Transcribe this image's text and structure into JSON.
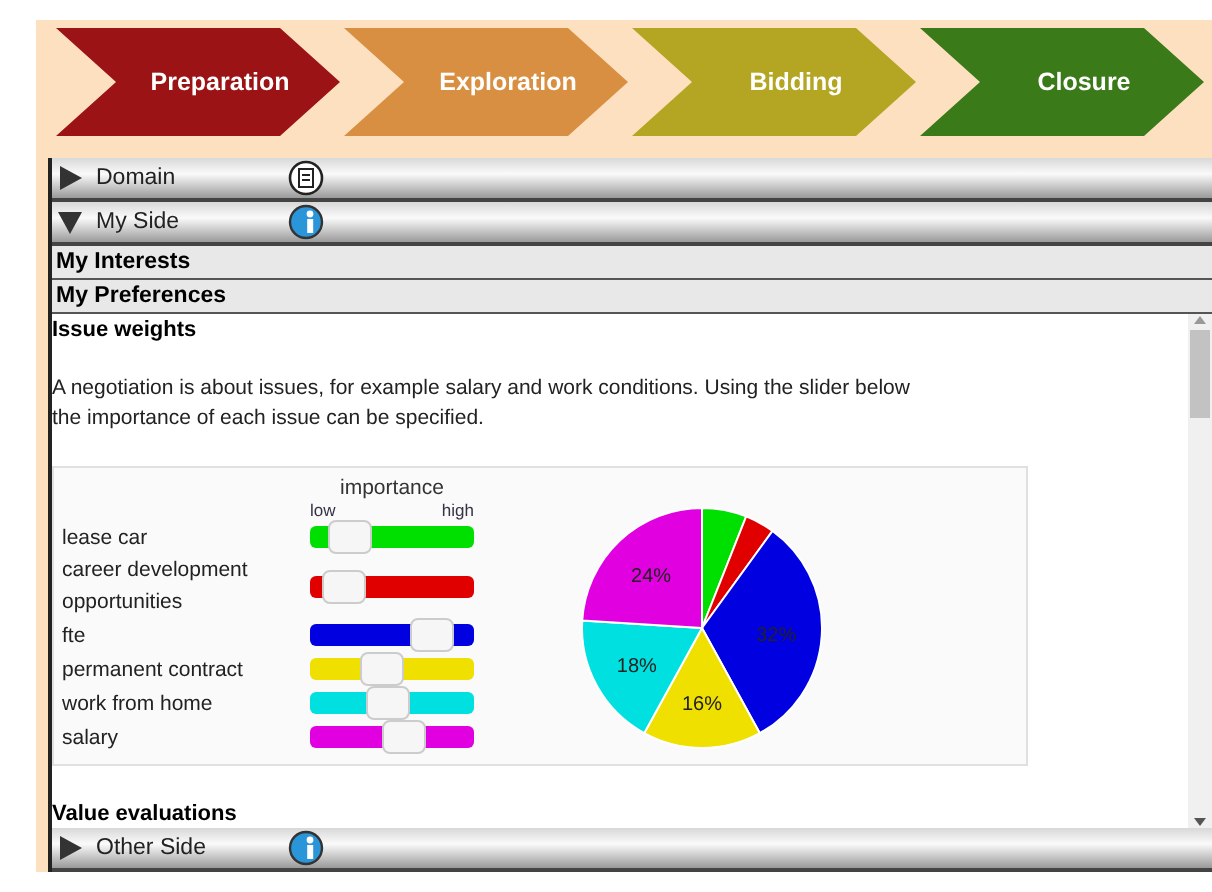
{
  "phases": [
    {
      "label": "Preparation",
      "color": "#9c1316"
    },
    {
      "label": "Exploration",
      "color": "#d98f41"
    },
    {
      "label": "Bidding",
      "color": "#b4a522"
    },
    {
      "label": "Closure",
      "color": "#3a7a18"
    }
  ],
  "sections": [
    {
      "label": "Domain",
      "kind": "domain",
      "expanded": false
    },
    {
      "label": "My Side",
      "kind": "party",
      "expanded": true,
      "subsections": [
        "My Interests",
        "My Preferences"
      ],
      "content": {
        "heading": "Issue weights",
        "paragraph": "A negotiation is about issues, for example salary and work conditions. Using the slider below the importance of each issue can be specified.",
        "weights": {
          "title": "importance",
          "low": "low",
          "high": "high",
          "issues": [
            {
              "name": "lease car",
              "color": "#00e000",
              "level": 0.15
            },
            {
              "name": "career development opportunities",
              "color": "#e00000",
              "level": 0.1
            },
            {
              "name": "fte",
              "color": "#0000e0",
              "level": 0.83
            },
            {
              "name": "permanent contract",
              "color": "#f0e000",
              "level": 0.41
            },
            {
              "name": "work from home",
              "color": "#00e0e0",
              "level": 0.46
            },
            {
              "name": "salary",
              "color": "#e000e0",
              "level": 0.6
            }
          ],
          "chart_data": {
            "type": "pie",
            "values": [
              6,
              4,
              32,
              16,
              18,
              24
            ],
            "value_labels": [
              null,
              null,
              "32%",
              "16%",
              "18%",
              "24%"
            ]
          }
        },
        "next_heading": "Value evaluations"
      }
    },
    {
      "label": "Other Side",
      "kind": "party",
      "expanded": false
    }
  ]
}
